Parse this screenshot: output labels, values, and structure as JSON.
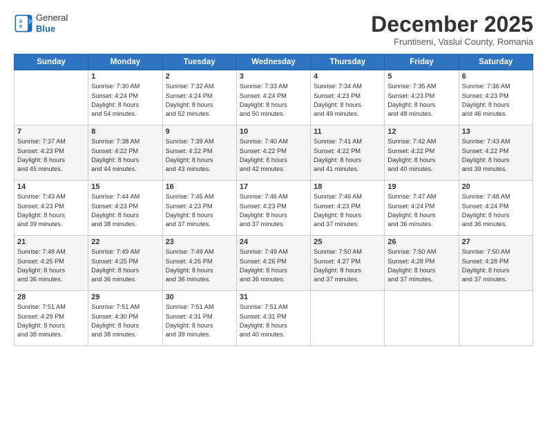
{
  "logo": {
    "general": "General",
    "blue": "Blue"
  },
  "title": "December 2025",
  "subtitle": "Fruntiseni, Vaslui County, Romania",
  "days_header": [
    "Sunday",
    "Monday",
    "Tuesday",
    "Wednesday",
    "Thursday",
    "Friday",
    "Saturday"
  ],
  "weeks": [
    [
      {
        "day": "",
        "info": ""
      },
      {
        "day": "1",
        "info": "Sunrise: 7:30 AM\nSunset: 4:24 PM\nDaylight: 8 hours\nand 54 minutes."
      },
      {
        "day": "2",
        "info": "Sunrise: 7:32 AM\nSunset: 4:24 PM\nDaylight: 8 hours\nand 52 minutes."
      },
      {
        "day": "3",
        "info": "Sunrise: 7:33 AM\nSunset: 4:24 PM\nDaylight: 8 hours\nand 50 minutes."
      },
      {
        "day": "4",
        "info": "Sunrise: 7:34 AM\nSunset: 4:23 PM\nDaylight: 8 hours\nand 49 minutes."
      },
      {
        "day": "5",
        "info": "Sunrise: 7:35 AM\nSunset: 4:23 PM\nDaylight: 8 hours\nand 48 minutes."
      },
      {
        "day": "6",
        "info": "Sunrise: 7:36 AM\nSunset: 4:23 PM\nDaylight: 8 hours\nand 46 minutes."
      }
    ],
    [
      {
        "day": "7",
        "info": "Sunrise: 7:37 AM\nSunset: 4:23 PM\nDaylight: 8 hours\nand 45 minutes."
      },
      {
        "day": "8",
        "info": "Sunrise: 7:38 AM\nSunset: 4:22 PM\nDaylight: 8 hours\nand 44 minutes."
      },
      {
        "day": "9",
        "info": "Sunrise: 7:39 AM\nSunset: 4:22 PM\nDaylight: 8 hours\nand 43 minutes."
      },
      {
        "day": "10",
        "info": "Sunrise: 7:40 AM\nSunset: 4:22 PM\nDaylight: 8 hours\nand 42 minutes."
      },
      {
        "day": "11",
        "info": "Sunrise: 7:41 AM\nSunset: 4:22 PM\nDaylight: 8 hours\nand 41 minutes."
      },
      {
        "day": "12",
        "info": "Sunrise: 7:42 AM\nSunset: 4:22 PM\nDaylight: 8 hours\nand 40 minutes."
      },
      {
        "day": "13",
        "info": "Sunrise: 7:43 AM\nSunset: 4:22 PM\nDaylight: 8 hours\nand 39 minutes."
      }
    ],
    [
      {
        "day": "14",
        "info": "Sunrise: 7:43 AM\nSunset: 4:23 PM\nDaylight: 8 hours\nand 39 minutes."
      },
      {
        "day": "15",
        "info": "Sunrise: 7:44 AM\nSunset: 4:23 PM\nDaylight: 8 hours\nand 38 minutes."
      },
      {
        "day": "16",
        "info": "Sunrise: 7:45 AM\nSunset: 4:23 PM\nDaylight: 8 hours\nand 37 minutes."
      },
      {
        "day": "17",
        "info": "Sunrise: 7:46 AM\nSunset: 4:23 PM\nDaylight: 8 hours\nand 37 minutes."
      },
      {
        "day": "18",
        "info": "Sunrise: 7:46 AM\nSunset: 4:23 PM\nDaylight: 8 hours\nand 37 minutes."
      },
      {
        "day": "19",
        "info": "Sunrise: 7:47 AM\nSunset: 4:24 PM\nDaylight: 8 hours\nand 36 minutes."
      },
      {
        "day": "20",
        "info": "Sunrise: 7:48 AM\nSunset: 4:24 PM\nDaylight: 8 hours\nand 36 minutes."
      }
    ],
    [
      {
        "day": "21",
        "info": "Sunrise: 7:48 AM\nSunset: 4:25 PM\nDaylight: 8 hours\nand 36 minutes."
      },
      {
        "day": "22",
        "info": "Sunrise: 7:49 AM\nSunset: 4:25 PM\nDaylight: 8 hours\nand 36 minutes."
      },
      {
        "day": "23",
        "info": "Sunrise: 7:49 AM\nSunset: 4:26 PM\nDaylight: 8 hours\nand 36 minutes."
      },
      {
        "day": "24",
        "info": "Sunrise: 7:49 AM\nSunset: 4:26 PM\nDaylight: 8 hours\nand 36 minutes."
      },
      {
        "day": "25",
        "info": "Sunrise: 7:50 AM\nSunset: 4:27 PM\nDaylight: 8 hours\nand 37 minutes."
      },
      {
        "day": "26",
        "info": "Sunrise: 7:50 AM\nSunset: 4:28 PM\nDaylight: 8 hours\nand 37 minutes."
      },
      {
        "day": "27",
        "info": "Sunrise: 7:50 AM\nSunset: 4:28 PM\nDaylight: 8 hours\nand 37 minutes."
      }
    ],
    [
      {
        "day": "28",
        "info": "Sunrise: 7:51 AM\nSunset: 4:29 PM\nDaylight: 8 hours\nand 38 minutes."
      },
      {
        "day": "29",
        "info": "Sunrise: 7:51 AM\nSunset: 4:30 PM\nDaylight: 8 hours\nand 38 minutes."
      },
      {
        "day": "30",
        "info": "Sunrise: 7:51 AM\nSunset: 4:31 PM\nDaylight: 8 hours\nand 39 minutes."
      },
      {
        "day": "31",
        "info": "Sunrise: 7:51 AM\nSunset: 4:31 PM\nDaylight: 8 hours\nand 40 minutes."
      },
      {
        "day": "",
        "info": ""
      },
      {
        "day": "",
        "info": ""
      },
      {
        "day": "",
        "info": ""
      }
    ]
  ]
}
